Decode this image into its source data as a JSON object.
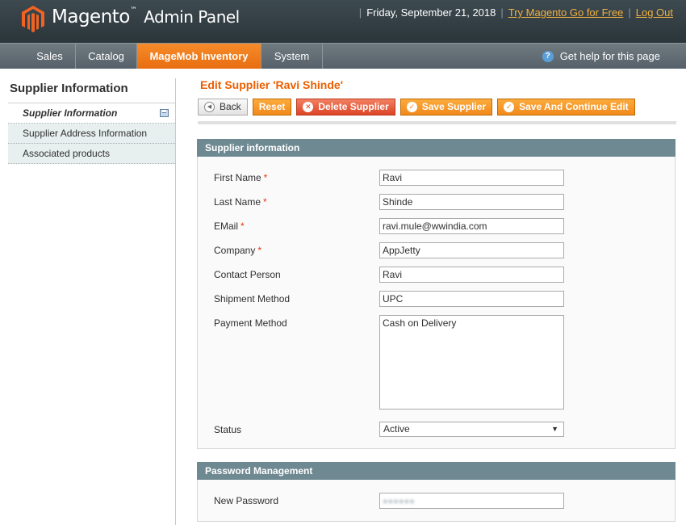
{
  "header": {
    "app_title": "Magento",
    "app_subtitle": "Admin Panel",
    "date": "Friday, September 21, 2018",
    "try_link": "Try Magento Go for Free",
    "logout_link": "Log Out",
    "logo_color": "#f26322"
  },
  "nav": {
    "items": [
      {
        "label": "Sales"
      },
      {
        "label": "Catalog"
      },
      {
        "label": "MageMob Inventory",
        "active": true
      },
      {
        "label": "System"
      }
    ],
    "help": "Get help for this page"
  },
  "sidebar": {
    "title": "Supplier Information",
    "items": [
      {
        "label": "Supplier Information",
        "active": true
      },
      {
        "label": "Supplier Address Information"
      },
      {
        "label": "Associated products"
      }
    ]
  },
  "page": {
    "title": "Edit Supplier 'Ravi Shinde'",
    "buttons": {
      "back": "Back",
      "reset": "Reset",
      "delete": "Delete Supplier",
      "save": "Save Supplier",
      "save_continue": "Save And Continue Edit"
    }
  },
  "supplier_section": {
    "title": "Supplier information",
    "fields": {
      "first_name": {
        "label": "First Name",
        "required": "*",
        "value": "Ravi"
      },
      "last_name": {
        "label": "Last Name",
        "required": "*",
        "value": "Shinde"
      },
      "email": {
        "label": "EMail",
        "required": "*",
        "value": "ravi.mule@wwindia.com"
      },
      "company": {
        "label": "Company",
        "required": "*",
        "value": "AppJetty"
      },
      "contact_person": {
        "label": "Contact Person",
        "value": "Ravi"
      },
      "shipment_method": {
        "label": "Shipment Method",
        "value": "UPC"
      },
      "payment_method": {
        "label": "Payment Method",
        "value": "Cash on Delivery"
      },
      "status": {
        "label": "Status",
        "value": "Active"
      }
    }
  },
  "password_section": {
    "title": "Password Management",
    "new_password_label": "New Password"
  }
}
